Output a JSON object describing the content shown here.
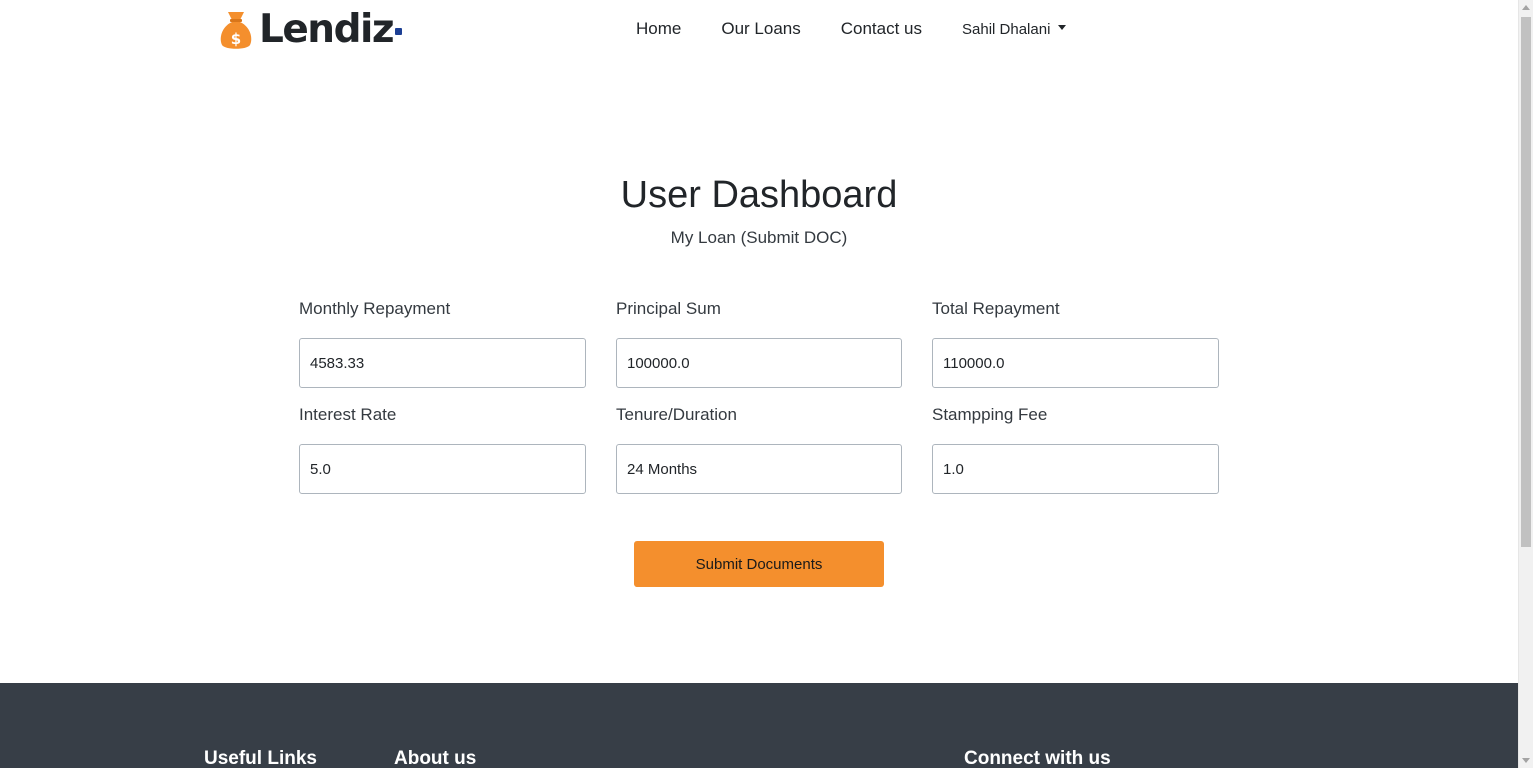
{
  "brand": {
    "name": "Lendiz",
    "icon": "money-bag-icon",
    "icon_color": "#f48f2d",
    "dot_color": "#1c3f94"
  },
  "nav": {
    "home": "Home",
    "loans": "Our Loans",
    "contact": "Contact us",
    "user": "Sahil Dhalani"
  },
  "dashboard": {
    "title": "User Dashboard",
    "subtitle": "My Loan (Submit DOC)"
  },
  "fields": {
    "monthly_repayment": {
      "label": "Monthly Repayment",
      "value": "4583.33"
    },
    "principal_sum": {
      "label": "Principal Sum",
      "value": "100000.0"
    },
    "total_repayment": {
      "label": "Total Repayment",
      "value": "110000.0"
    },
    "interest_rate": {
      "label": "Interest Rate",
      "value": "5.0"
    },
    "tenure": {
      "label": "Tenure/Duration",
      "value": "24 Months"
    },
    "stamping_fee": {
      "label": "Stampping Fee",
      "value": "1.0"
    }
  },
  "actions": {
    "submit_label": "Submit Documents",
    "submit_color": "#f48f2d"
  },
  "footer": {
    "background": "#373e47",
    "useful_links": "Useful Links",
    "about_us": "About us",
    "connect": "Connect with us"
  }
}
